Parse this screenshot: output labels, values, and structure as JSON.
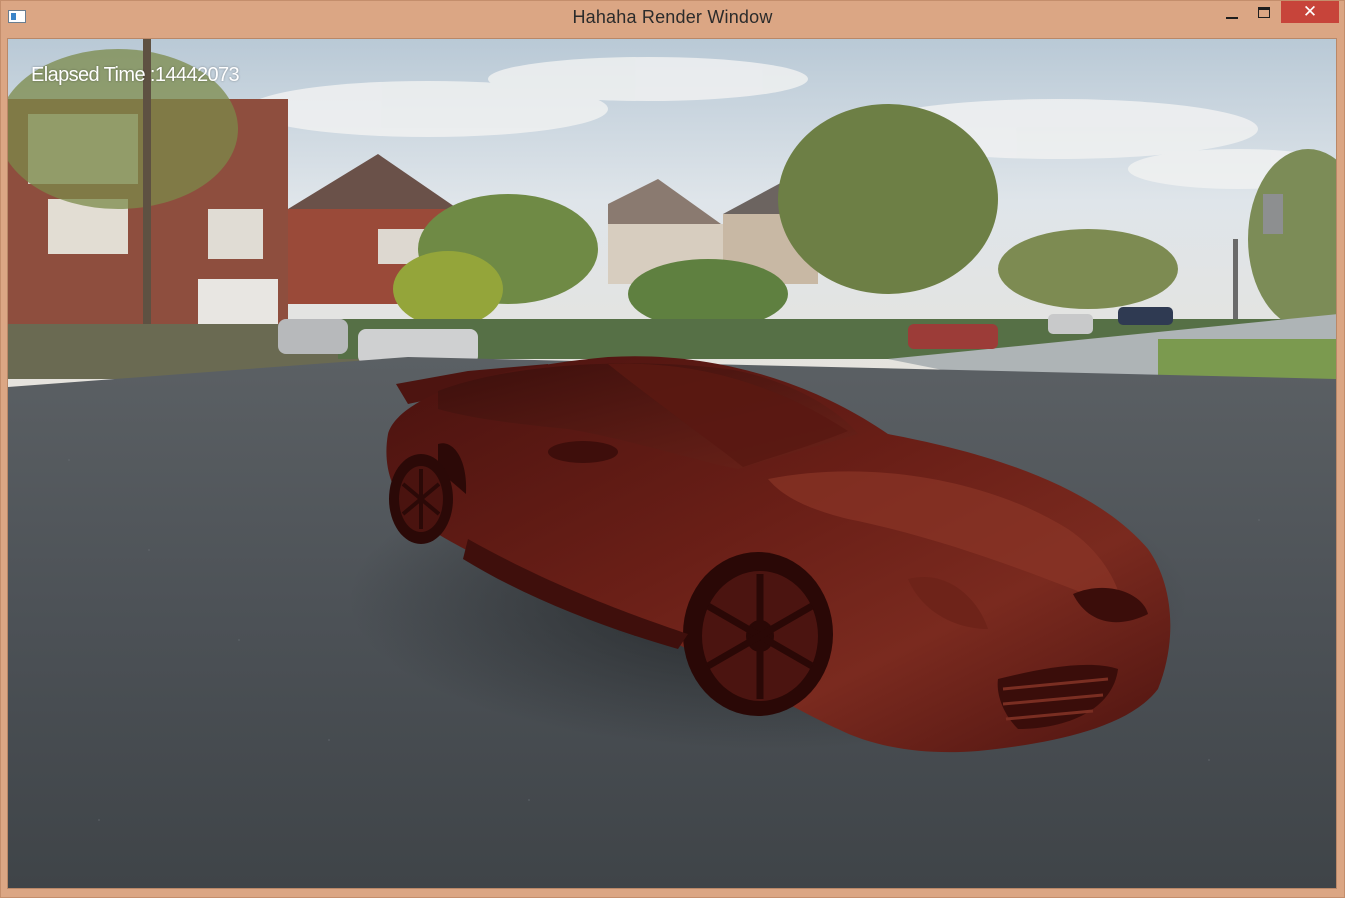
{
  "window": {
    "title": "Hahaha Render Window",
    "close_glyph": "✕",
    "titlebar_color": "#dba684",
    "close_color": "#c7443a"
  },
  "viewport": {
    "hud_label": "Elapsed Time :14442073",
    "car_color": "#5a1712",
    "ground_color": "#4a4f54",
    "sky_color": "#c9d6e2"
  },
  "icons": {
    "app": "app-window-icon",
    "minimize": "minimize-icon",
    "maximize": "maximize-icon",
    "close": "close-icon"
  }
}
